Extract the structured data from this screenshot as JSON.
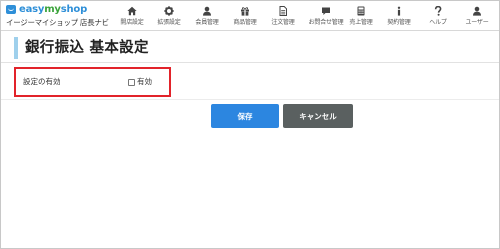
{
  "header": {
    "logo": {
      "brand_easy": "easy",
      "brand_my": "my",
      "brand_shop": "shop",
      "subtitle": "イージーマイショップ 店長ナビ"
    },
    "nav": [
      {
        "label": "開店設定",
        "icon": "home-icon"
      },
      {
        "label": "拡張設定",
        "icon": "gear-icon"
      },
      {
        "label": "会員管理",
        "icon": "person-icon"
      },
      {
        "label": "商品管理",
        "icon": "gift-icon"
      },
      {
        "label": "注文管理",
        "icon": "document-icon"
      },
      {
        "label": "お問合せ管理",
        "icon": "chat-icon"
      },
      {
        "label": "売上管理",
        "icon": "calculator-icon"
      },
      {
        "label": "契約管理",
        "icon": "info-icon"
      },
      {
        "label": "ヘルプ",
        "icon": "question-icon"
      },
      {
        "label": "ユーザー",
        "icon": "user-icon"
      }
    ]
  },
  "page": {
    "title": "銀行振込 基本設定"
  },
  "settings": {
    "label": "設定の有効",
    "checkbox_label": "有効",
    "checked": false
  },
  "actions": {
    "save_label": "保存",
    "cancel_label": "キャンセル"
  },
  "colors": {
    "accent": "#2c86e0",
    "highlight": "#e2232a",
    "title_bar": "#9fd0ec"
  }
}
